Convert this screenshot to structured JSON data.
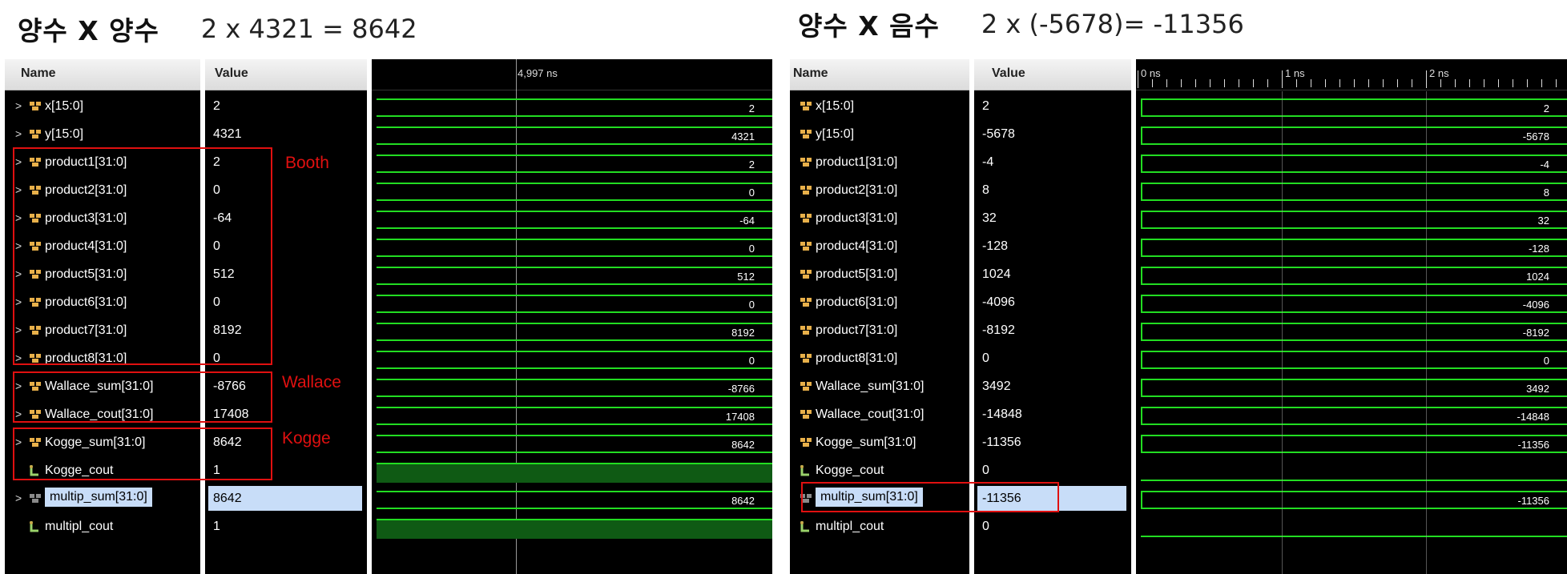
{
  "left": {
    "title": "양수 X 양수",
    "equation": "2 x 4321  =  8642",
    "headers": {
      "name": "Name",
      "value": "Value"
    },
    "cursor_label": "4,997 ns",
    "annotations": {
      "booth": "Booth",
      "wallace": "Wallace",
      "kogge": "Kogge"
    },
    "signals": [
      {
        "name": "x[15:0]",
        "value": "2",
        "wave": "2",
        "type": "bus"
      },
      {
        "name": "y[15:0]",
        "value": "4321",
        "wave": "4321",
        "type": "bus"
      },
      {
        "name": "product1[31:0]",
        "value": "2",
        "wave": "2",
        "type": "bus"
      },
      {
        "name": "product2[31:0]",
        "value": "0",
        "wave": "0",
        "type": "bus"
      },
      {
        "name": "product3[31:0]",
        "value": "-64",
        "wave": "-64",
        "type": "bus"
      },
      {
        "name": "product4[31:0]",
        "value": "0",
        "wave": "0",
        "type": "bus"
      },
      {
        "name": "product5[31:0]",
        "value": "512",
        "wave": "512",
        "type": "bus"
      },
      {
        "name": "product6[31:0]",
        "value": "0",
        "wave": "0",
        "type": "bus"
      },
      {
        "name": "product7[31:0]",
        "value": "8192",
        "wave": "8192",
        "type": "bus"
      },
      {
        "name": "product8[31:0]",
        "value": "0",
        "wave": "0",
        "type": "bus"
      },
      {
        "name": "Wallace_sum[31:0]",
        "value": "-8766",
        "wave": "-8766",
        "type": "bus"
      },
      {
        "name": "Wallace_cout[31:0]",
        "value": "17408",
        "wave": "17408",
        "type": "bus"
      },
      {
        "name": "Kogge_sum[31:0]",
        "value": "8642",
        "wave": "8642",
        "type": "bus"
      },
      {
        "name": "Kogge_cout",
        "value": "1",
        "wave": "",
        "type": "bit-high"
      },
      {
        "name": "multip_sum[31:0]",
        "value": "8642",
        "wave": "8642",
        "type": "bus",
        "selected": true
      },
      {
        "name": "multipl_cout",
        "value": "1",
        "wave": "",
        "type": "bit-high"
      }
    ]
  },
  "right": {
    "title": "양수 X 음수",
    "equation": "2 x (-5678)=  -11356",
    "headers": {
      "name": "Name",
      "value": "Value"
    },
    "ruler_labels": [
      "0 ns",
      "1 ns",
      "2 ns"
    ],
    "signals": [
      {
        "name": "x[15:0]",
        "value": "2",
        "wave": "2",
        "type": "bus"
      },
      {
        "name": "y[15:0]",
        "value": "-5678",
        "wave": "-5678",
        "type": "bus"
      },
      {
        "name": "product1[31:0]",
        "value": "-4",
        "wave": "-4",
        "type": "bus"
      },
      {
        "name": "product2[31:0]",
        "value": "8",
        "wave": "8",
        "type": "bus"
      },
      {
        "name": "product3[31:0]",
        "value": "32",
        "wave": "32",
        "type": "bus"
      },
      {
        "name": "product4[31:0]",
        "value": "-128",
        "wave": "-128",
        "type": "bus"
      },
      {
        "name": "product5[31:0]",
        "value": "1024",
        "wave": "1024",
        "type": "bus"
      },
      {
        "name": "product6[31:0]",
        "value": "-4096",
        "wave": "-4096",
        "type": "bus"
      },
      {
        "name": "product7[31:0]",
        "value": "-8192",
        "wave": "-8192",
        "type": "bus"
      },
      {
        "name": "product8[31:0]",
        "value": "0",
        "wave": "0",
        "type": "bus"
      },
      {
        "name": "Wallace_sum[31:0]",
        "value": "3492",
        "wave": "3492",
        "type": "bus"
      },
      {
        "name": "Wallace_cout[31:0]",
        "value": "-14848",
        "wave": "-14848",
        "type": "bus"
      },
      {
        "name": "Kogge_sum[31:0]",
        "value": "-11356",
        "wave": "-11356",
        "type": "bus"
      },
      {
        "name": "Kogge_cout",
        "value": "0",
        "wave": "",
        "type": "bit-low"
      },
      {
        "name": "multip_sum[31:0]",
        "value": "-11356",
        "wave": "-11356",
        "type": "bus",
        "selected": true
      },
      {
        "name": "multipl_cout",
        "value": "0",
        "wave": "",
        "type": "bit-low"
      }
    ]
  },
  "colors": {
    "wave_green": "#22dd22",
    "bit_fill": "#0f5a14",
    "selection": "#c8ddf8",
    "annotation_red": "#e01010"
  }
}
